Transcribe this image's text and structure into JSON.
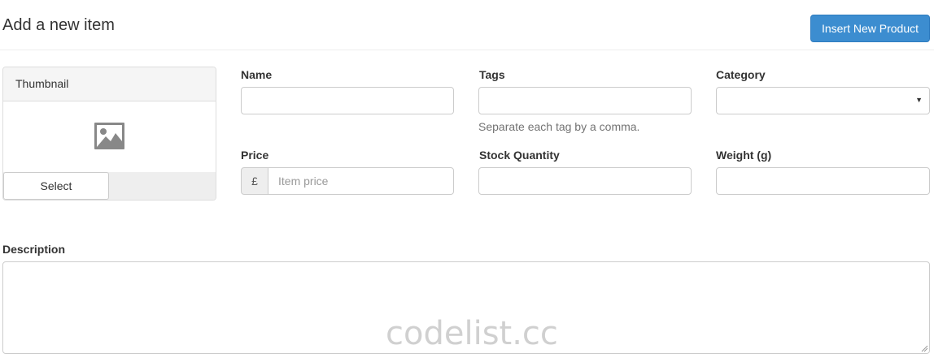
{
  "header": {
    "title": "Add a new item",
    "insert_button_label": "Insert New Product",
    "accent_color": "#3c8dd0"
  },
  "thumbnail": {
    "heading": "Thumbnail",
    "icon": "image-icon",
    "select_label": "Select"
  },
  "fields": {
    "name": {
      "label": "Name",
      "value": ""
    },
    "tags": {
      "label": "Tags",
      "value": "",
      "help": "Separate each tag by a comma."
    },
    "category": {
      "label": "Category",
      "value": "",
      "icon": "caret-down-icon"
    },
    "price": {
      "label": "Price",
      "currency": "£",
      "placeholder": "Item price",
      "value": ""
    },
    "stock": {
      "label": "Stock Quantity",
      "value": ""
    },
    "weight": {
      "label": "Weight (g)",
      "value": ""
    },
    "description": {
      "label": "Description",
      "value": ""
    }
  },
  "watermark": "codelist.cc"
}
